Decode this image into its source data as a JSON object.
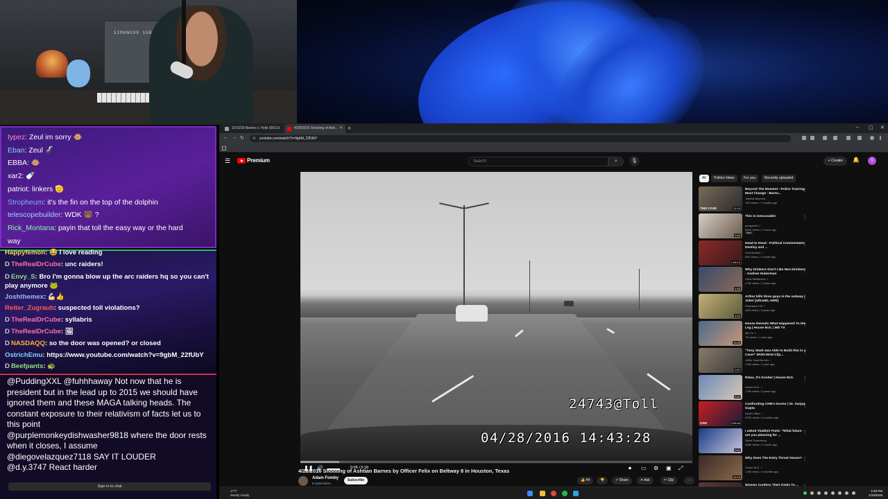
{
  "webcam": {
    "wall_text": "SIMONG99 SUBSCRIBES"
  },
  "chat_top": [
    {
      "user": "typez",
      "user_color": "#ff8fbf",
      "text": ": Zeul im sorry 🐵"
    },
    {
      "user": "Eban",
      "user_color": "#7fd4ff",
      "text": ": Zeul 🦨"
    },
    {
      "user": "EBBA",
      "user_color": "#ffffff",
      "text": ": 🐵"
    },
    {
      "user": "xar2",
      "user_color": "#ffffff",
      "text": ": 🍼"
    },
    {
      "user": "patriot",
      "user_color": "#ffffff",
      "text": ": linkers 🫡"
    },
    {
      "user": "Stropheum",
      "user_color": "#7fb0ff",
      "text": ": it's the fin on the top of the dolphin"
    },
    {
      "user": "telescopebuilder",
      "user_color": "#9fd0ff",
      "text": ": WDK 🐻 ?"
    },
    {
      "user": "Rick_Montana",
      "user_color": "#7fffaa",
      "text": ": payin that toll the easy way or the hard"
    },
    {
      "user": "",
      "user_color": "#ffffff",
      "text": "way"
    }
  ],
  "chat_mid": [
    {
      "badge": "",
      "user": "Happyfemon",
      "user_color": "#ffd25a",
      "text": ": 😂 I love reading"
    },
    {
      "badge": "D",
      "user": "TheRealDrCube",
      "user_color": "#ff6fb0",
      "text": ": unc raiders!"
    },
    {
      "badge": "D",
      "user": "Envy_S",
      "user_color": "#8fe07a",
      "text": ": Bro I'm gonna blow up the arc raiders hq so you can't play anymore 🐸",
      "wrap": true
    },
    {
      "badge": "",
      "user": "Joshthemex",
      "user_color": "#9fb8ff",
      "text": ": 💪🏻👍"
    },
    {
      "badge": "",
      "user": "Reiter_Zugraub",
      "user_color": "#ff5a5a",
      "text": ": suspected toll violations?"
    },
    {
      "badge": "D",
      "user": "TheRealDrCube",
      "user_color": "#ff6fb0",
      "text": ": syllabris"
    },
    {
      "badge": "D",
      "user": "TheRealDrCube",
      "user_color": "#ff6fb0",
      "text": ": 🖼"
    },
    {
      "badge": "D",
      "user": "NASDAQQ",
      "user_color": "#ffb23a",
      "text": ": so the door was opened? or closed"
    },
    {
      "badge": "",
      "user": "OstrichEmu",
      "user_color": "#7fd4ff",
      "text": ": https://www.youtube.com/watch?v=9gbM_22fUbY"
    },
    {
      "badge": "D",
      "user": "Beefpants",
      "user_color": "#8fe07a",
      "text": ": 🐢"
    }
  ],
  "chat_bottom": [
    "@PuddingXXL @fuhhhaway Not now that he is president but in the lead up to 2015 we should have ignored them and these MAGA talking heads. The constant exposure to their relativism of facts let us to this point",
    "@purplemonkeydishwasher9818 where the door rests when it closes, I assume",
    "@diegovelazquez7118 SAY IT LOUDER",
    "@d.y.3747 React harder"
  ],
  "chat_signin": "Sign in to chat",
  "browser": {
    "tabs": [
      {
        "label": "23-5239 Barnes v. Felix (05/1...",
        "fav_color": "#9aa0a6",
        "active": false
      },
      {
        "label": "4/28/2016 Shooting of Ash...",
        "fav_color": "#ff0000",
        "active": true
      }
    ],
    "new_tab": "+",
    "url": "youtube.com/watch?v=9gbM_22fUbY",
    "win_min": "–",
    "win_max": "▢",
    "win_close": "✕"
  },
  "youtube": {
    "brand": "Premium",
    "search_placeholder": "Search",
    "create": "+ Create",
    "avatar_letter": "S",
    "overlay_id": "24743@Toll",
    "overlay_datetime": "04/28/2016  14:43:28",
    "time": "0:06 / 5:18",
    "progress": 0.02,
    "video_title": "4/28/2016 Shooting of Ashtian Barnes by Officer Felix on Beltway 8 in Houston, Texas",
    "channel": "Adam Fomby",
    "subscribers": "8 subscribers",
    "subscribe": "Subscribe",
    "actions": [
      "👍 44",
      "👎",
      "↗ Share",
      "✦ Ask",
      "✂ Clip",
      "⋯"
    ],
    "chips": [
      "All",
      "Politics News",
      "For you",
      "Recently uploaded"
    ],
    "recommendations": [
      {
        "title": "Beyond The Moment - Police Training Must Change - Barne...",
        "channel": "Tactical Attorney",
        "meta": "10K views • 7 months ago",
        "duration": "11:10",
        "tag": "THIS CASE",
        "c1": "#7a6a5a",
        "c2": "#2a2a2a"
      },
      {
        "title": "This is inexcusable",
        "channel": "penguinz0 ✓",
        "meta": "802K views • 2 hours ago",
        "duration": "9:20",
        "tag": "",
        "new": "New",
        "c1": "#d8d0c8",
        "c2": "#6a5a4a"
      },
      {
        "title": "Head to Head - Political Commentator Destiny and ...",
        "channel": "OxfordUnion ✓",
        "meta": "64K views • 1 month ago",
        "duration": "1:06:13",
        "tag": "",
        "c1": "#8a2a2a",
        "c2": "#3a1a1a"
      },
      {
        "title": "Why Drinkers Don't Like Non-Drinkers - Andrew Huberman",
        "channel": "Chris Williamson ✓",
        "meta": "2.4M views • 2 years ago",
        "duration": "4:53",
        "tag": "",
        "c1": "#3a4a6a",
        "c2": "#8a6a5a"
      },
      {
        "title": "Arthur kills three guys in the subway | Joker [UltraHD, HDR]",
        "channel": "Flashback FM ✓",
        "meta": "44M views • 5 years ago",
        "duration": "4:02",
        "tag": "",
        "c1": "#c4b078",
        "c2": "#5a5a3a"
      },
      {
        "title": "House Reveals What Happened To His Leg | House M.D. | MD TV",
        "channel": "MD TV ✓",
        "meta": "7M views • 1 year ago",
        "duration": "11:09",
        "tag": "",
        "c1": "#4a6a8a",
        "c2": "#c89878"
      },
      {
        "title": "\"Tony Stark was Able to Build this in a Cave!\" IRON MAN Clip...",
        "channel": "JoBlo Superheroes ✓",
        "meta": "2.8M views • 1 year ago",
        "duration": "2:57",
        "tag": "",
        "c1": "#8a7a6a",
        "c2": "#3a3a3a"
      },
      {
        "title": "Relax, It's Kosher | House M.D.",
        "channel": "House M.D. ✓",
        "meta": "1.5M views • 4 years ago",
        "duration": "5:37",
        "tag": "",
        "c1": "#6a8ab8",
        "c2": "#d8c8b8"
      },
      {
        "title": "Confronting CNN's Doctor | Dr. Sanjay Gupta",
        "channel": "Doctor Mike ✓",
        "meta": "202K views • 4 months ago",
        "duration": "2:05:45",
        "tag": "CNN",
        "c1": "#c82020",
        "c2": "#1a1a3a"
      },
      {
        "title": "I asked Vladimir Putin: \"What future are you planning for ...",
        "channel": "Steve Rosenberg",
        "meta": "408K views • 1 month ago",
        "duration": "9:51",
        "tag": "",
        "c1": "#1a3a8a",
        "c2": "#c8c8d8"
      },
      {
        "title": "Why Does The Entry Thrust House?",
        "channel": "House M.D. ✓",
        "meta": "1.9M views • 4 months ago",
        "duration": "10:19",
        "tag": "",
        "c1": "#3a2a2a",
        "c2": "#8a6a4a"
      },
      {
        "title": "Women Confess Their Kinks To ...",
        "channel": "",
        "meta": "",
        "duration": "",
        "tag": "",
        "c1": "#5a3a3a",
        "c2": "#2a1a1a"
      }
    ]
  },
  "taskbar": {
    "weather_temp": "17°F",
    "weather_desc": "Mostly cloudy",
    "time": "4:35 PM",
    "date": "1/19/2026"
  }
}
